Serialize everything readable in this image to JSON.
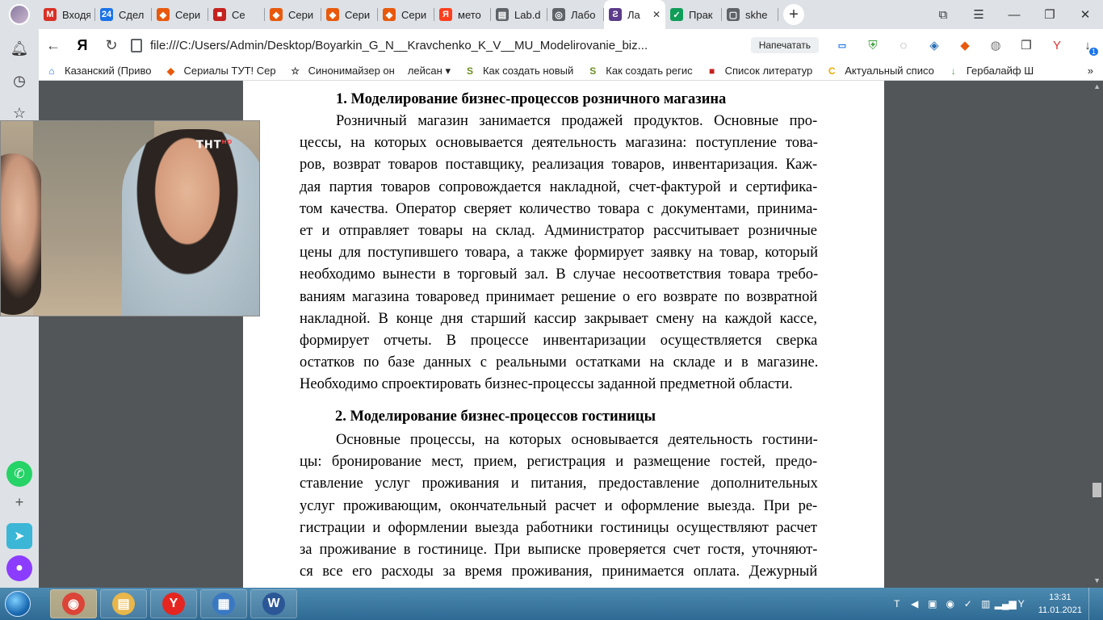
{
  "tabs": [
    {
      "label": "Входя",
      "icon": "gmail-icon",
      "color": "#d93025",
      "glyph": "M"
    },
    {
      "label": "Сдел",
      "icon": "calendar24-icon",
      "color": "#1a73e8",
      "glyph": "24"
    },
    {
      "label": "Сери",
      "icon": "fox-icon",
      "color": "#e8590c",
      "glyph": "◆"
    },
    {
      "label": "Се",
      "icon": "book-red-icon",
      "color": "#c5221f",
      "glyph": "■"
    },
    {
      "label": "Сери",
      "icon": "fox-icon",
      "color": "#e8590c",
      "glyph": "◆"
    },
    {
      "label": "Сери",
      "icon": "fox-icon",
      "color": "#e8590c",
      "glyph": "◆"
    },
    {
      "label": "Сери",
      "icon": "fox-icon",
      "color": "#e8590c",
      "glyph": "◆"
    },
    {
      "label": "мето",
      "icon": "yandex-icon",
      "color": "#fc3f1d",
      "glyph": "Я"
    },
    {
      "label": "Lab.d",
      "icon": "document-icon",
      "color": "#5f6368",
      "glyph": "▤"
    },
    {
      "label": "Лабо",
      "icon": "globe-icon",
      "color": "#5f6368",
      "glyph": "◎"
    }
  ],
  "active_tab": {
    "label": "Ла",
    "icon": "word-doc-icon",
    "color": "#5c3b8a",
    "glyph": "Ƨ",
    "close": "✕"
  },
  "tabs_after": [
    {
      "label": "Прак",
      "icon": "check-icon",
      "color": "#0f9d58",
      "glyph": "✓"
    },
    {
      "label": "skhe",
      "icon": "file-icon",
      "color": "#5f6368",
      "glyph": "▢"
    }
  ],
  "toolbar": {
    "back": "←",
    "yandex": "Я",
    "reload": "↻",
    "url": "file:///C:/Users/Admin/Desktop/Boyarkin_G_N__Kravchenko_K_V__MU_Modelirovanie_biz...",
    "print_label": "Напечатать",
    "download_badge": "1"
  },
  "bookmarks": [
    {
      "label": "Казанский (Приво",
      "icon": "museum-icon",
      "color": "#1a73e8",
      "glyph": "⌂"
    },
    {
      "label": "Сериалы ТУТ! Сер",
      "icon": "fox-icon",
      "color": "#e8590c",
      "glyph": "◆"
    },
    {
      "label": "Синонимайзер он",
      "icon": "star-icon",
      "color": "#333333",
      "glyph": "☆"
    },
    {
      "label": "лейсан ▾",
      "icon": "",
      "color": "#333333",
      "glyph": ""
    },
    {
      "label": "Как создать новый",
      "icon": "s-icon",
      "color": "#6b8e23",
      "glyph": "S"
    },
    {
      "label": "Как создать регис",
      "icon": "s-icon",
      "color": "#6b8e23",
      "glyph": "S"
    },
    {
      "label": "Список литератур",
      "icon": "book-red-icon",
      "color": "#c5221f",
      "glyph": "■"
    },
    {
      "label": "Актуальный списо",
      "icon": "c-icon",
      "color": "#f2a900",
      "glyph": "C"
    },
    {
      "label": "Гербалайф Ш",
      "icon": "herbalife-icon",
      "color": "#3c9d3c",
      "glyph": "↓"
    }
  ],
  "document": {
    "heading1": "1.  Моделирование бизнес-процессов розничного магазина",
    "para1_lines": [
      "Розничный магазин занимается продажей продуктов. Основные про-",
      "цессы, на которых основывается деятельность магазина: поступление това-",
      "ров, возврат товаров поставщику, реализация товаров, инвентаризация. Каж-",
      "дая партия товаров сопровождается накладной, счет-фактурой и сертифика-",
      "том качества. Оператор сверяет количество товара с документами, принима-",
      "ет и отправляет товары на склад. Администратор рассчитывает розничные",
      "цены для поступившего товара, а также формирует заявку на товар, который",
      "необходимо вынести в торговый зал. В случае несоответствия товара требо-",
      "ваниям магазина товаровед принимает решение о его возврате по возвратной",
      "накладной. В конце дня старший кассир закрывает смену на каждой кассе,",
      "формирует отчеты. В процессе инвентаризации осуществляется сверка",
      "остатков по базе данных с реальными остатками на складе и в магазине.",
      "Необходимо спроектировать бизнес-процессы заданной предметной области."
    ],
    "heading2": "2. Моделирование бизнес-процессов гостиницы",
    "para2_lines": [
      "Основные процессы, на которых основывается деятельность гостини-",
      "цы: бронирование мест, прием, регистрация и размещение гостей, предо-",
      "ставление услуг проживания и питания, предоставление дополнительных",
      "услуг проживающим, окончательный расчет и оформление выезда. При ре-",
      "гистрации и оформлении выезда работники гостиницы осуществляют расчет",
      "за проживание в гостинице. При выписке проверяется счет гостя, уточняют-",
      "ся все его расходы за время проживания, принимается оплата. Дежурный"
    ]
  },
  "video": {
    "channel_logo": "ТНТ",
    "channel_sub": "HD"
  },
  "taskbar": {
    "time": "13:31",
    "date": "11.01.2021",
    "apps": [
      {
        "name": "chrome",
        "glyph": "◉",
        "color": "#db4437"
      },
      {
        "name": "explorer",
        "glyph": "▤",
        "color": "#e8b64a"
      },
      {
        "name": "yandex",
        "glyph": "Y",
        "color": "#e52620"
      },
      {
        "name": "control-panel",
        "glyph": "▦",
        "color": "#3a78c2"
      },
      {
        "name": "word",
        "glyph": "W",
        "color": "#2b5797"
      }
    ]
  },
  "colors": {
    "tab_bar": "#dee1e6",
    "pdf_bg": "#525659",
    "taskbar": "#2e6a93"
  }
}
